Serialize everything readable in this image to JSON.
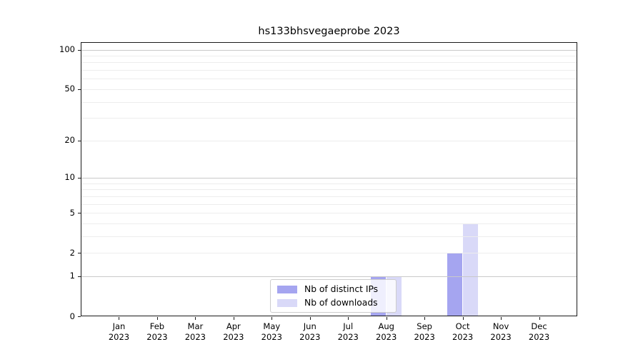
{
  "chart_data": {
    "type": "bar",
    "title": "hs133bhsvegaeprobe 2023",
    "categories": [
      "Jan 2023",
      "Feb 2023",
      "Mar 2023",
      "Apr 2023",
      "May 2023",
      "Jun 2023",
      "Jul 2023",
      "Aug 2023",
      "Sep 2023",
      "Oct 2023",
      "Nov 2023",
      "Dec 2023"
    ],
    "series": [
      {
        "name": "Nb of distinct IPs",
        "color": "#a5a5f0",
        "values": [
          0,
          0,
          0,
          0,
          0,
          0,
          0,
          1,
          0,
          2,
          0,
          0
        ]
      },
      {
        "name": "Nb of downloads",
        "color": "#d9d9f8",
        "values": [
          0,
          0,
          0,
          0,
          0,
          0,
          0,
          1,
          0,
          4,
          0,
          0
        ]
      }
    ],
    "y_axis": {
      "scale": "log1p",
      "ticks": [
        0,
        1,
        2,
        5,
        10,
        20,
        50,
        100
      ],
      "major_gridlines": [
        1,
        10,
        100
      ],
      "minor_gridlines": [
        2,
        3,
        4,
        5,
        6,
        7,
        8,
        9,
        20,
        30,
        40,
        50,
        60,
        70,
        80,
        90
      ],
      "range": [
        0,
        113
      ]
    },
    "x_axis": {
      "tick_label_lines": 2
    },
    "legend": {
      "position": "lower center"
    },
    "grid": true,
    "colors": {
      "grid_major": "#c9c9c9",
      "grid_minor": "#ededed",
      "spine": "#1a1a1a",
      "text": "#000000",
      "background": "#ffffff"
    }
  }
}
